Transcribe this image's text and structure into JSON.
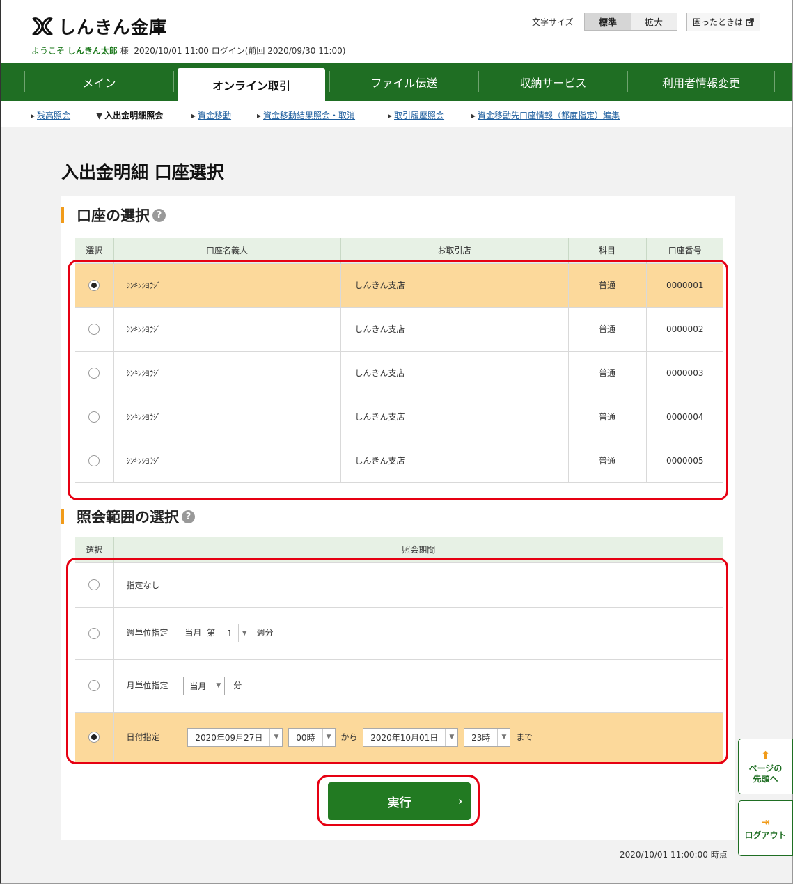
{
  "header": {
    "logo_text": "しんきん金庫",
    "welcome_prefix": "ようこそ",
    "user_name": "しんきん太郎",
    "user_suffix": "様",
    "login_info": "2020/10/01 11:00 ログイン(前回 2020/09/30 11:00)",
    "font_size_label": "文字サイズ",
    "font_standard": "標準",
    "font_large": "拡大",
    "help_label": "困ったときは"
  },
  "nav": {
    "items": [
      "メイン",
      "オンライン取引",
      "ファイル伝送",
      "収納サービス",
      "利用者情報変更"
    ],
    "active_index": 1
  },
  "subnav": {
    "items": [
      "残高照会",
      "入出金明細照会",
      "資金移動",
      "資金移動結果照会・取消",
      "取引履歴照会",
      "資金移動先口座情報（都度指定）編集"
    ],
    "current_index": 1
  },
  "page_title": "入出金明細 口座選択",
  "account_section": {
    "title": "口座の選択",
    "columns": [
      "選択",
      "口座名義人",
      "お取引店",
      "科目",
      "口座番号"
    ],
    "rows": [
      {
        "holder": "ｼﾝｷﾝｼﾖｳｼﾞ",
        "branch": "しんきん支店",
        "type": "普通",
        "number": "0000001",
        "selected": true
      },
      {
        "holder": "ｼﾝｷﾝｼﾖｳｼﾞ",
        "branch": "しんきん支店",
        "type": "普通",
        "number": "0000002",
        "selected": false
      },
      {
        "holder": "ｼﾝｷﾝｼﾖｳｼﾞ",
        "branch": "しんきん支店",
        "type": "普通",
        "number": "0000003",
        "selected": false
      },
      {
        "holder": "ｼﾝｷﾝｼﾖｳｼﾞ",
        "branch": "しんきん支店",
        "type": "普通",
        "number": "0000004",
        "selected": false
      },
      {
        "holder": "ｼﾝｷﾝｼﾖｳｼﾞ",
        "branch": "しんきん支店",
        "type": "普通",
        "number": "0000005",
        "selected": false
      }
    ]
  },
  "range_section": {
    "title": "照会範囲の選択",
    "columns": [
      "選択",
      "照会期間"
    ],
    "none_label": "指定なし",
    "week_label": "週単位指定",
    "week_prefix_1": "当月",
    "week_prefix_2": "第",
    "week_value": "1",
    "week_suffix": "週分",
    "month_label": "月単位指定",
    "month_value": "当月",
    "month_suffix": "分",
    "date_label": "日付指定",
    "from_date": "2020年09月27日",
    "from_hour": "00時",
    "from_text": "から",
    "to_date": "2020年10月01日",
    "to_hour": "23時",
    "to_text": "まで",
    "selected": "date"
  },
  "run_label": "実行",
  "timestamp": "2020/10/01 11:00:00 時点",
  "side": {
    "top_label_1": "ページの",
    "top_label_2": "先頭へ",
    "logout_label": "ログアウト"
  },
  "colors": {
    "brand_green": "#1f6e23",
    "highlight_row": "#fcd99b",
    "accent_orange": "#f19b1a",
    "annotation_red": "#e60012"
  }
}
